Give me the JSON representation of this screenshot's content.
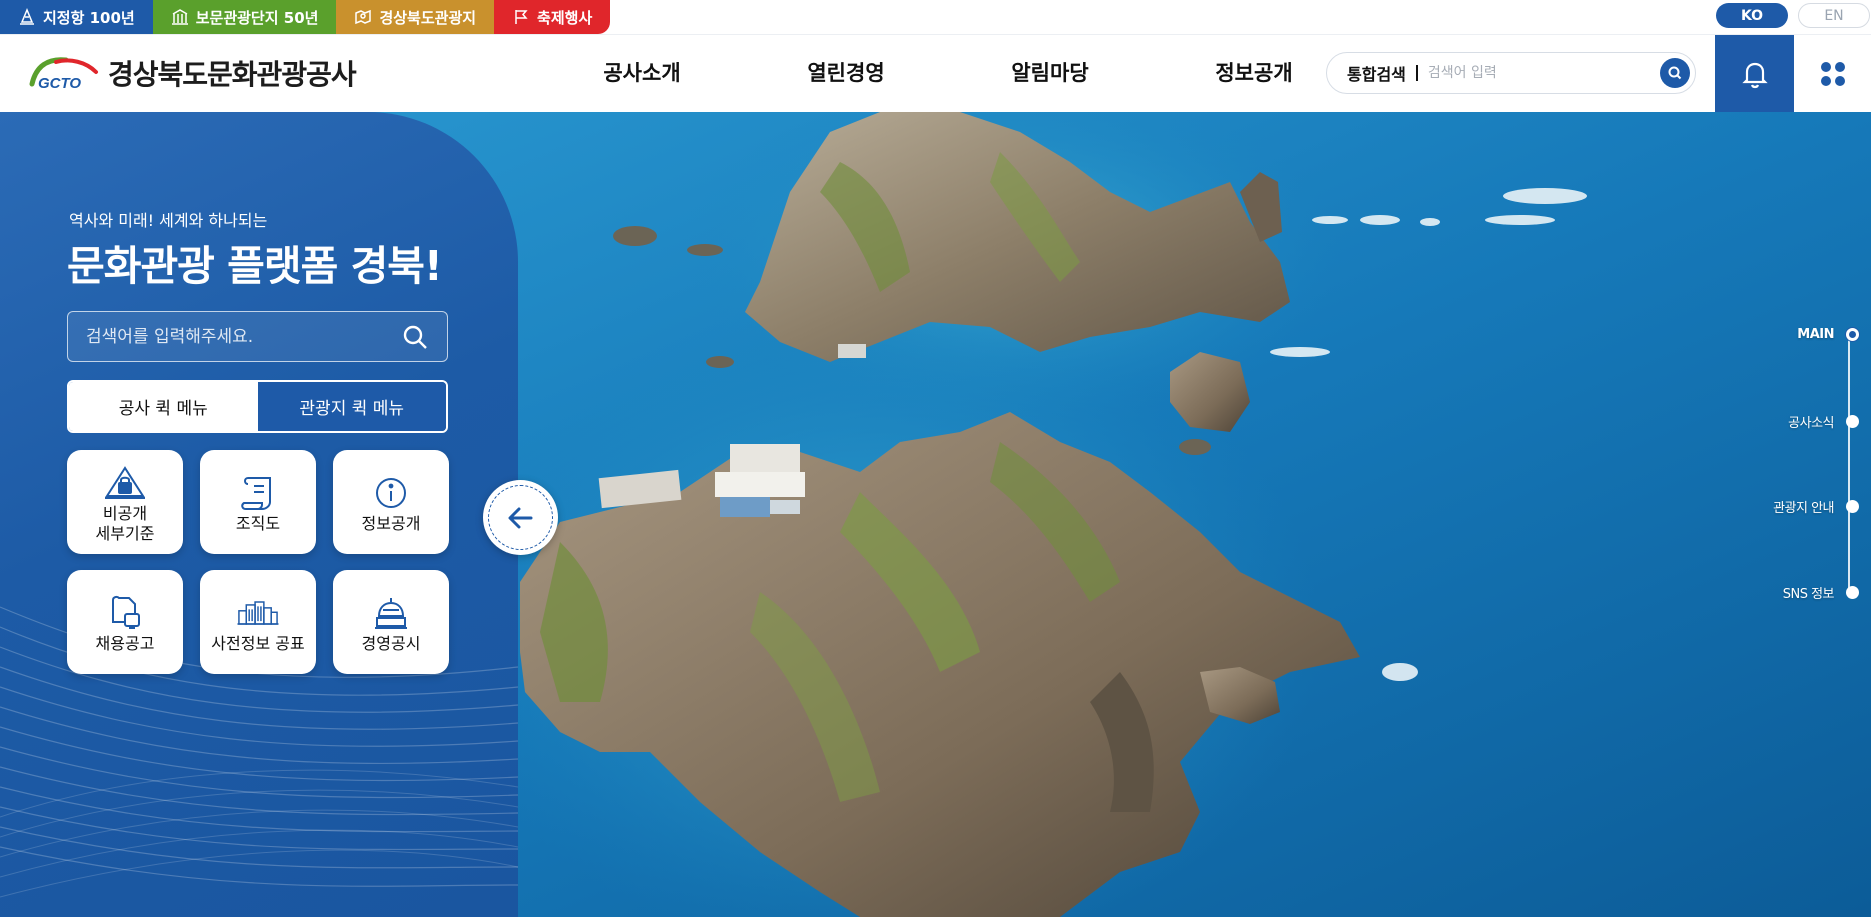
{
  "top_tabs": [
    {
      "label": "지정항 100년",
      "color": "#1e5aa8",
      "icon": "monument-icon"
    },
    {
      "label": "보문관광단지 50년",
      "color": "#5aa02c",
      "icon": "building-icon"
    },
    {
      "label": "경상북도관광지",
      "color": "#c9912d",
      "icon": "map-icon"
    },
    {
      "label": "축제행사",
      "color": "#e0262b",
      "icon": "flag-icon"
    }
  ],
  "lang": {
    "ko": "KO",
    "en": "EN"
  },
  "header": {
    "logo_mark": "GCTO",
    "logo_text": "경상북도문화관광공사",
    "nav": [
      "공사소개",
      "열린경영",
      "알림마당",
      "정보공개"
    ],
    "search_label": "통합검색",
    "search_placeholder": "검색어 입력"
  },
  "panel": {
    "subtitle": "역사와 미래! 세계와 하나되는",
    "title": "문화관광 플랫폼 경북!",
    "search_placeholder": "검색어를 입력해주세요.",
    "tabs": [
      "공사 퀵 메뉴",
      "관광지 퀵 메뉴"
    ],
    "active_tab": "공사 퀵 메뉴",
    "quick_menu": [
      {
        "label": "비공개\n세부기준",
        "icon": "lock-house-icon"
      },
      {
        "label": "조직도",
        "icon": "scroll-icon"
      },
      {
        "label": "정보공개",
        "icon": "info-icon"
      },
      {
        "label": "채용공고",
        "icon": "document-card-icon"
      },
      {
        "label": "사전정보 공표",
        "icon": "buildings-icon"
      },
      {
        "label": "경영공시",
        "icon": "dome-icon"
      }
    ]
  },
  "indicator": [
    "MAIN",
    "공사소식",
    "관광지 안내",
    "SNS 정보"
  ],
  "indicator_active": "MAIN",
  "colors": {
    "brand": "#1e5aa8",
    "sea": "#1a78b8",
    "rock": "#8b7d68",
    "grass": "#7a9a3a"
  }
}
